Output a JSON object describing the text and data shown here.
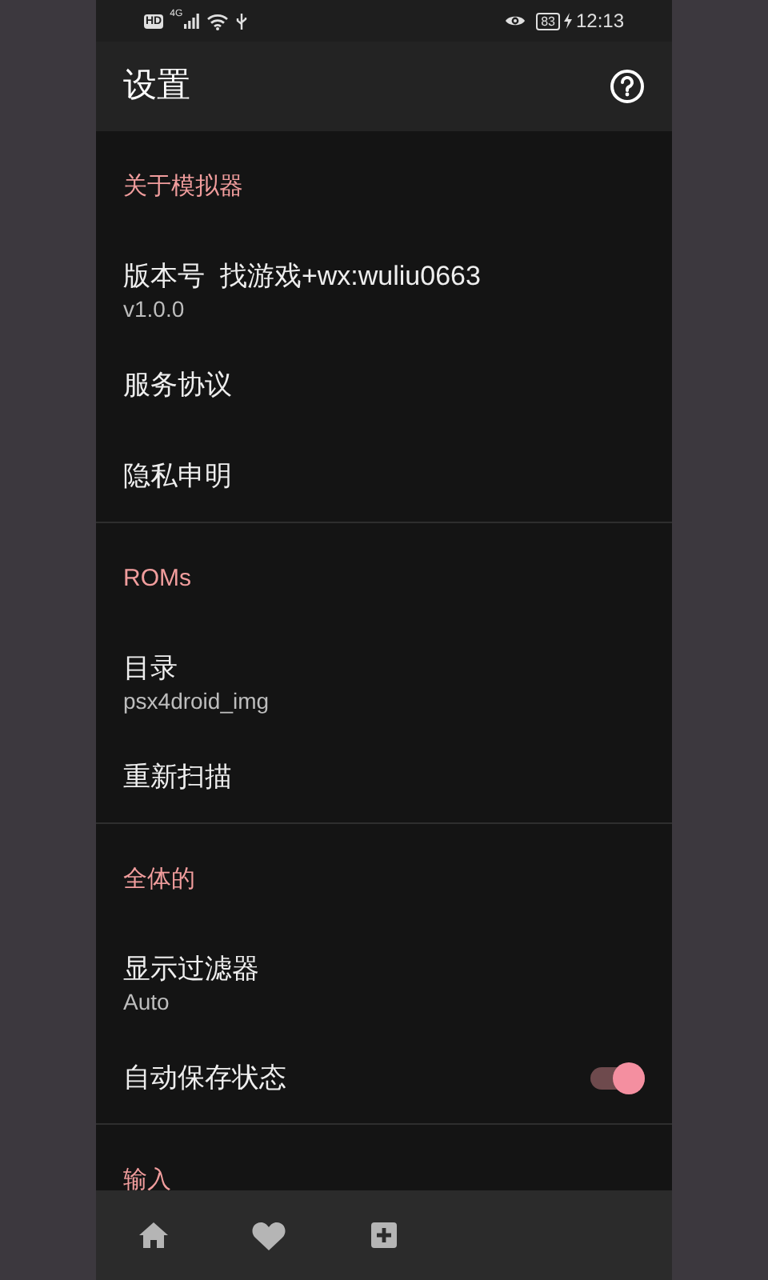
{
  "status_bar": {
    "hd_badge": "HD",
    "network": "4G",
    "battery": "83",
    "charging": true,
    "time": "12:13"
  },
  "app_bar": {
    "title": "设置"
  },
  "sections": [
    {
      "header": "关于模拟器",
      "items": [
        {
          "kind": "text",
          "title": "版本号  找游戏+wx:wuliu0663",
          "subtitle": "v1.0.0"
        },
        {
          "kind": "text",
          "title": "服务协议"
        },
        {
          "kind": "text",
          "title": "隐私申明"
        }
      ]
    },
    {
      "header": "ROMs",
      "items": [
        {
          "kind": "text",
          "title": "目录",
          "subtitle": "psx4droid_img"
        },
        {
          "kind": "text",
          "title": "重新扫描"
        }
      ]
    },
    {
      "header": "全体的",
      "items": [
        {
          "kind": "text",
          "title": "显示过滤器",
          "subtitle": "Auto"
        },
        {
          "kind": "toggle",
          "title": "自动保存状态",
          "on": true
        }
      ]
    },
    {
      "header": "输入"
    }
  ],
  "bottom_nav": [
    {
      "kind": "home"
    },
    {
      "kind": "heart"
    },
    {
      "kind": "plus"
    }
  ]
}
